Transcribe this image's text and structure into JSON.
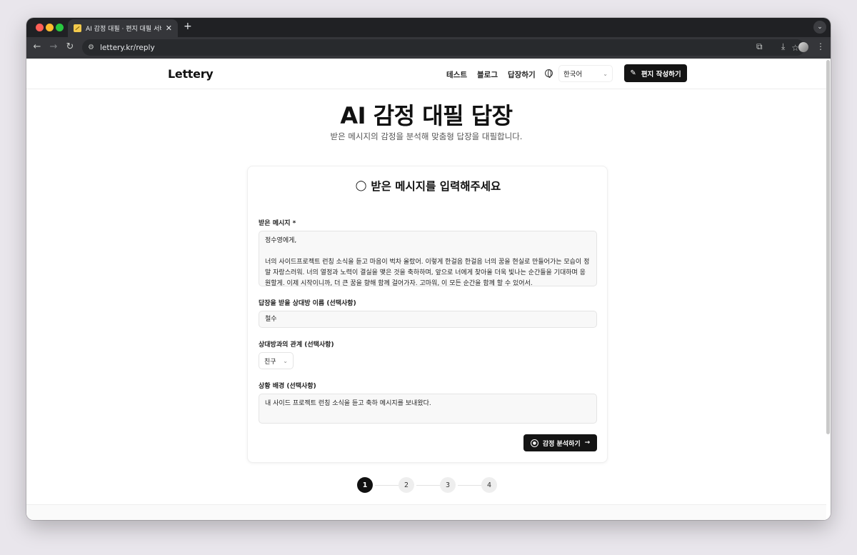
{
  "browser": {
    "tab_title": "AI 감정 대필 · 편지 대필 서비스 - L",
    "tab_close": "✕",
    "new_tab": "+",
    "url": "lettery.kr/reply"
  },
  "header": {
    "logo": "Lettery",
    "nav": [
      "테스트",
      "블로그",
      "답장하기"
    ],
    "language": "한국어",
    "write_button": "편지 작성하기"
  },
  "hero": {
    "title": "AI 감정 대필 답장",
    "subtitle": "받은 메시지의 감정을 분석해 맞춤형 답장을 대필합니다."
  },
  "form": {
    "card_title": "받은 메시지를 입력해주세요",
    "message_label": "받은 메시지 *",
    "message_value": "정수영에게,\n\n너의 사이드프로젝트 런칭 소식을 듣고 마음이 벅차 올랐어. 이렇게 한걸음 한걸음 너의 꿈을 현실로 만들어가는 모습이 정말 자랑스러워. 너의 열정과 노력이 결실을 맺은 것을 축하하며, 앞으로 너에게 찾아올 더욱 빛나는 순간들을 기대하며 응원할게. 이제 시작이니까, 더 큰 꿈을 향해 함께 걸어가자. 고마워, 이 모든 순간을 함께 할 수 있어서.",
    "recipient_label": "답장을 받을 상대방 이름 (선택사항)",
    "recipient_value": "철수",
    "relation_label": "상대방과의 관계 (선택사항)",
    "relation_value": "친구",
    "context_label": "상황 배경 (선택사항)",
    "context_value": "내 사이드 프로젝트 런칭 소식을 듣고 축하 메시지를 보내왔다.",
    "submit_button": "감정 분석하기"
  },
  "steps": [
    "1",
    "2",
    "3",
    "4"
  ],
  "colors": {
    "primary": "#141414",
    "background": "#ffffff",
    "input_bg": "#f8f8f8"
  }
}
